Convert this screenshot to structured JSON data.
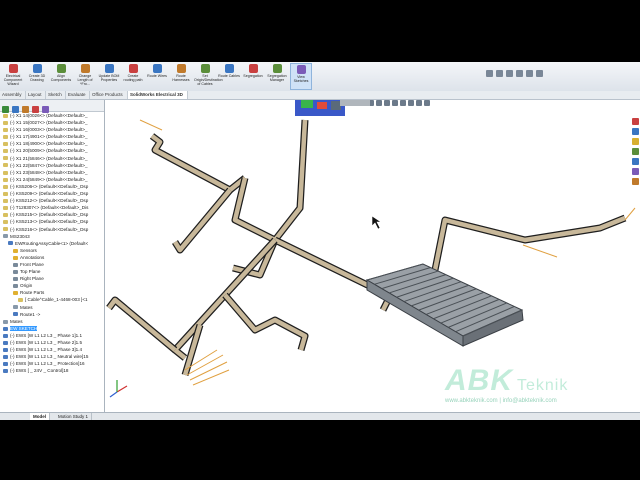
{
  "ribbon": {
    "buttons": [
      {
        "label": "Electrical Component Wizard",
        "color": "#c94040"
      },
      {
        "label": "Create 3D Drawing",
        "color": "#3a76c2"
      },
      {
        "label": "Align Components",
        "color": "#5b8e3a"
      },
      {
        "label": "Change Length of *Fro...",
        "color": "#c07a2b"
      },
      {
        "label": "Update BOM Properties",
        "color": "#3a76c2"
      },
      {
        "label": "Create routing path",
        "color": "#c94040"
      },
      {
        "label": "Route Wires",
        "color": "#3a76c2"
      },
      {
        "label": "Route Harnesses",
        "color": "#c07a2b"
      },
      {
        "label": "Set Origin/Destination of Cables",
        "color": "#5b8e3a"
      },
      {
        "label": "Route Cables",
        "color": "#3a76c2"
      },
      {
        "label": "Segregation",
        "color": "#c94040"
      },
      {
        "label": "Segregation Manager",
        "color": "#5b8e3a"
      },
      {
        "label": "View Sketches",
        "color": "#7a5bb8"
      }
    ]
  },
  "tabs": [
    "Assembly",
    "Layout",
    "Sketch",
    "Evaluate",
    "Office Products",
    "SolidWorks Electrical 3D"
  ],
  "active_tab": "SolidWorks Electrical 3D",
  "tree": [
    {
      "label": "(-) X1 14(0026<> (Default<<Default>_",
      "color": "#d8c060",
      "indent": 0
    },
    {
      "label": "(-) X1 15(0027<> (Default<<Default>_",
      "color": "#d8c060",
      "indent": 0
    },
    {
      "label": "(-) X1 16(0003<> (Default<<Default>_",
      "color": "#d8c060",
      "indent": 0
    },
    {
      "label": "(-) X1 17(4901<> (Default<<Default>_",
      "color": "#d8c060",
      "indent": 0
    },
    {
      "label": "(-) X1 18(4900<> (Default<<Default>_",
      "color": "#d8c060",
      "indent": 0
    },
    {
      "label": "(-) X1 20(5009<> (Default<<Default>_",
      "color": "#d8c060",
      "indent": 0
    },
    {
      "label": "(-) X1 21(5846<> (Default<<Default>_",
      "color": "#d8c060",
      "indent": 0
    },
    {
      "label": "(-) X1 22(5847<> (Default<<Default>_",
      "color": "#d8c060",
      "indent": 0
    },
    {
      "label": "(-) X1 23(5848<> (Default<<Default>_",
      "color": "#d8c060",
      "indent": 0
    },
    {
      "label": "(-) X1 24(5849<> (Default<<Default>_",
      "color": "#d8c060",
      "indent": 0
    },
    {
      "label": "(-) KS5206<> (Default<<Default>_Dsp",
      "color": "#d8c060",
      "indent": 0
    },
    {
      "label": "(-) KS5209<> (Default<<Default>_Dsp",
      "color": "#d8c060",
      "indent": 0
    },
    {
      "label": "(-) KS5212<> (Default<<Default>_Dsp",
      "color": "#d8c060",
      "indent": 0
    },
    {
      "label": "(-) T128307<> (Default<<Default>_Dis",
      "color": "#d8c060",
      "indent": 0
    },
    {
      "label": "(-) KS5215<> (Default<<Default>_Dsp",
      "color": "#d8c060",
      "indent": 0
    },
    {
      "label": "(-) KS5213<> (Default<<Default>_Dsp",
      "color": "#d8c060",
      "indent": 0
    },
    {
      "label": "(-) KS5216<> (Default<<Default>_Dsp",
      "color": "#d8c060",
      "indent": 0
    },
    {
      "label": "MS23043",
      "color": "#8899aa",
      "indent": 0
    },
    {
      "label": "EWRoutingAssyCable<1> (Default<",
      "color": "#4a7ac0",
      "indent": 1
    },
    {
      "label": "Sensors",
      "color": "#e0b030",
      "indent": 2
    },
    {
      "label": "Annotations",
      "color": "#e0b030",
      "indent": 2
    },
    {
      "label": "Front Plane",
      "color": "#7a8a9a",
      "indent": 2
    },
    {
      "label": "Top Plane",
      "color": "#7a8a9a",
      "indent": 2
    },
    {
      "label": "Right Plane",
      "color": "#7a8a9a",
      "indent": 2
    },
    {
      "label": "Origin",
      "color": "#7a8a9a",
      "indent": 2
    },
    {
      "label": "Route Parts",
      "color": "#e0b030",
      "indent": 2
    },
    {
      "label": "[ Cable^Cable_1-4468-003 ]<1",
      "color": "#d8c060",
      "indent": 3
    },
    {
      "label": "Mates",
      "color": "#8899aa",
      "indent": 2
    },
    {
      "label": "Route1 ->",
      "color": "#4a7ac0",
      "indent": 2
    },
    {
      "label": "Mates",
      "color": "#8899aa",
      "indent": 0
    },
    {
      "label": "EW SKETCH",
      "color": "#4a7ac0",
      "indent": 0,
      "selected": true
    },
    {
      "label": "(-) EWS [W L1 L2 L3 _ Phase 1]1.1",
      "color": "#4a7ac0",
      "indent": 0
    },
    {
      "label": "(-) EWS [W L1 L2 L3 _ Phase 2]1.5",
      "color": "#4a7ac0",
      "indent": 0
    },
    {
      "label": "(-) EWS [W L1 L2 L3 _ Phase 3]1.4",
      "color": "#4a7ac0",
      "indent": 0
    },
    {
      "label": "(-) EWS [W L1 L2 L3 _ Neutral wire]15",
      "color": "#4a7ac0",
      "indent": 0
    },
    {
      "label": "(-) EWS [W L1 L2 L3 _ Protection]16",
      "color": "#4a7ac0",
      "indent": 0
    },
    {
      "label": "(-) EWS [ _ 24V _ Control]18",
      "color": "#4a7ac0",
      "indent": 0
    }
  ],
  "bottom_tabs": [
    "Model",
    "Motion Study 1"
  ],
  "active_bottom_tab": "Model",
  "watermark": {
    "brand": "ABK",
    "suffix": "Teknik",
    "contact": "www.abkteknik.com | info@abkteknik.com"
  },
  "colors": {
    "tray_fill": "#c8b89a",
    "tray_edge": "#1e1e1e",
    "wire": "#e0a040"
  }
}
